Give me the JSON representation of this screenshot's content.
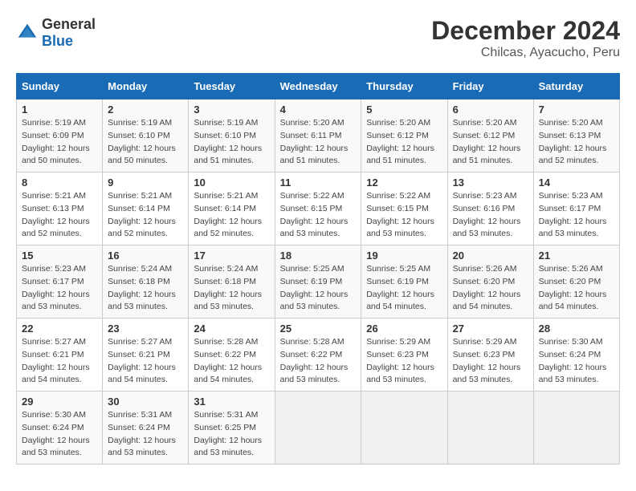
{
  "header": {
    "logo_general": "General",
    "logo_blue": "Blue",
    "title": "December 2024",
    "subtitle": "Chilcas, Ayacucho, Peru"
  },
  "calendar": {
    "days_of_week": [
      "Sunday",
      "Monday",
      "Tuesday",
      "Wednesday",
      "Thursday",
      "Friday",
      "Saturday"
    ],
    "weeks": [
      [
        {
          "day": "",
          "empty": true
        },
        {
          "day": "",
          "empty": true
        },
        {
          "day": "",
          "empty": true
        },
        {
          "day": "",
          "empty": true
        },
        {
          "day": "",
          "empty": true
        },
        {
          "day": "",
          "empty": true
        },
        {
          "day": "",
          "empty": true
        }
      ],
      [
        {
          "day": "1",
          "sunrise": "5:19 AM",
          "sunset": "6:09 PM",
          "daylight": "12 hours and 50 minutes."
        },
        {
          "day": "2",
          "sunrise": "5:19 AM",
          "sunset": "6:10 PM",
          "daylight": "12 hours and 50 minutes."
        },
        {
          "day": "3",
          "sunrise": "5:19 AM",
          "sunset": "6:10 PM",
          "daylight": "12 hours and 51 minutes."
        },
        {
          "day": "4",
          "sunrise": "5:20 AM",
          "sunset": "6:11 PM",
          "daylight": "12 hours and 51 minutes."
        },
        {
          "day": "5",
          "sunrise": "5:20 AM",
          "sunset": "6:12 PM",
          "daylight": "12 hours and 51 minutes."
        },
        {
          "day": "6",
          "sunrise": "5:20 AM",
          "sunset": "6:12 PM",
          "daylight": "12 hours and 51 minutes."
        },
        {
          "day": "7",
          "sunrise": "5:20 AM",
          "sunset": "6:13 PM",
          "daylight": "12 hours and 52 minutes."
        }
      ],
      [
        {
          "day": "8",
          "sunrise": "5:21 AM",
          "sunset": "6:13 PM",
          "daylight": "12 hours and 52 minutes."
        },
        {
          "day": "9",
          "sunrise": "5:21 AM",
          "sunset": "6:14 PM",
          "daylight": "12 hours and 52 minutes."
        },
        {
          "day": "10",
          "sunrise": "5:21 AM",
          "sunset": "6:14 PM",
          "daylight": "12 hours and 52 minutes."
        },
        {
          "day": "11",
          "sunrise": "5:22 AM",
          "sunset": "6:15 PM",
          "daylight": "12 hours and 53 minutes."
        },
        {
          "day": "12",
          "sunrise": "5:22 AM",
          "sunset": "6:15 PM",
          "daylight": "12 hours and 53 minutes."
        },
        {
          "day": "13",
          "sunrise": "5:23 AM",
          "sunset": "6:16 PM",
          "daylight": "12 hours and 53 minutes."
        },
        {
          "day": "14",
          "sunrise": "5:23 AM",
          "sunset": "6:17 PM",
          "daylight": "12 hours and 53 minutes."
        }
      ],
      [
        {
          "day": "15",
          "sunrise": "5:23 AM",
          "sunset": "6:17 PM",
          "daylight": "12 hours and 53 minutes."
        },
        {
          "day": "16",
          "sunrise": "5:24 AM",
          "sunset": "6:18 PM",
          "daylight": "12 hours and 53 minutes."
        },
        {
          "day": "17",
          "sunrise": "5:24 AM",
          "sunset": "6:18 PM",
          "daylight": "12 hours and 53 minutes."
        },
        {
          "day": "18",
          "sunrise": "5:25 AM",
          "sunset": "6:19 PM",
          "daylight": "12 hours and 53 minutes."
        },
        {
          "day": "19",
          "sunrise": "5:25 AM",
          "sunset": "6:19 PM",
          "daylight": "12 hours and 54 minutes."
        },
        {
          "day": "20",
          "sunrise": "5:26 AM",
          "sunset": "6:20 PM",
          "daylight": "12 hours and 54 minutes."
        },
        {
          "day": "21",
          "sunrise": "5:26 AM",
          "sunset": "6:20 PM",
          "daylight": "12 hours and 54 minutes."
        }
      ],
      [
        {
          "day": "22",
          "sunrise": "5:27 AM",
          "sunset": "6:21 PM",
          "daylight": "12 hours and 54 minutes."
        },
        {
          "day": "23",
          "sunrise": "5:27 AM",
          "sunset": "6:21 PM",
          "daylight": "12 hours and 54 minutes."
        },
        {
          "day": "24",
          "sunrise": "5:28 AM",
          "sunset": "6:22 PM",
          "daylight": "12 hours and 54 minutes."
        },
        {
          "day": "25",
          "sunrise": "5:28 AM",
          "sunset": "6:22 PM",
          "daylight": "12 hours and 53 minutes."
        },
        {
          "day": "26",
          "sunrise": "5:29 AM",
          "sunset": "6:23 PM",
          "daylight": "12 hours and 53 minutes."
        },
        {
          "day": "27",
          "sunrise": "5:29 AM",
          "sunset": "6:23 PM",
          "daylight": "12 hours and 53 minutes."
        },
        {
          "day": "28",
          "sunrise": "5:30 AM",
          "sunset": "6:24 PM",
          "daylight": "12 hours and 53 minutes."
        }
      ],
      [
        {
          "day": "29",
          "sunrise": "5:30 AM",
          "sunset": "6:24 PM",
          "daylight": "12 hours and 53 minutes."
        },
        {
          "day": "30",
          "sunrise": "5:31 AM",
          "sunset": "6:24 PM",
          "daylight": "12 hours and 53 minutes."
        },
        {
          "day": "31",
          "sunrise": "5:31 AM",
          "sunset": "6:25 PM",
          "daylight": "12 hours and 53 minutes."
        },
        {
          "day": "",
          "empty": true
        },
        {
          "day": "",
          "empty": true
        },
        {
          "day": "",
          "empty": true
        },
        {
          "day": "",
          "empty": true
        }
      ]
    ]
  }
}
